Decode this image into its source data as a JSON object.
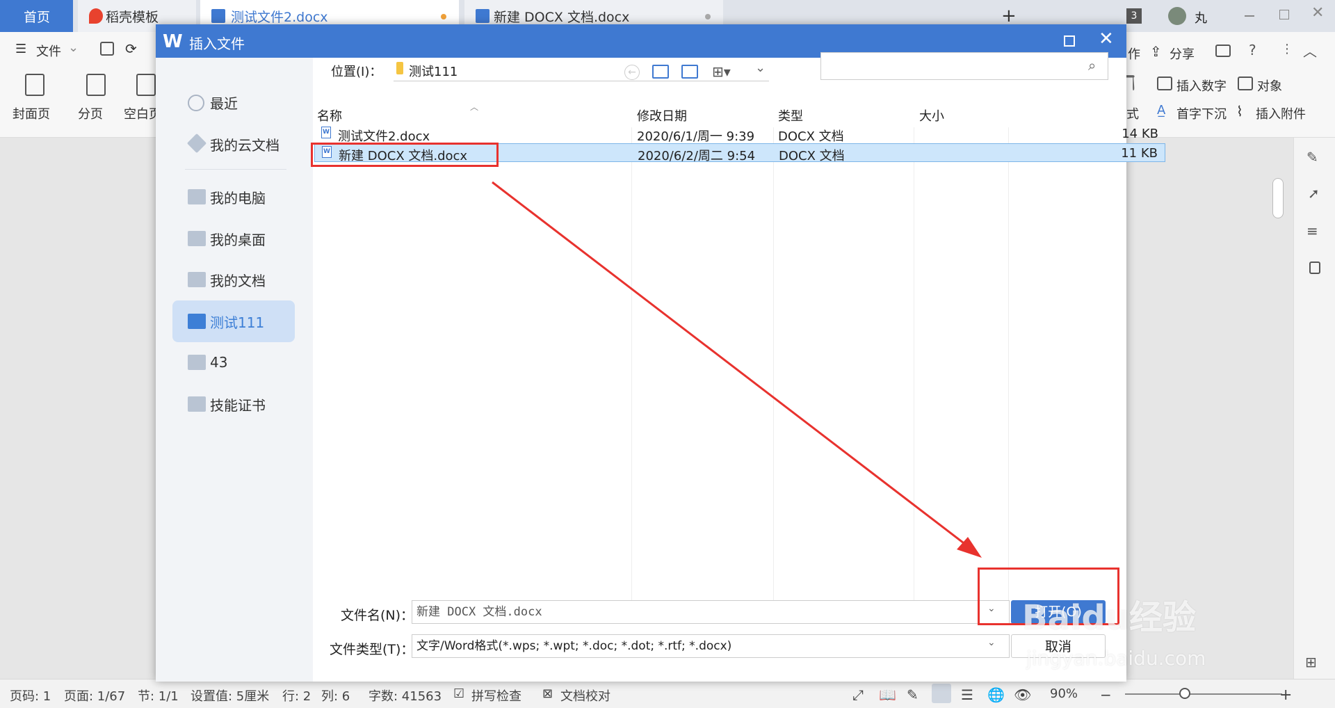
{
  "tabs": {
    "home": "首页",
    "template": "稻壳模板",
    "doc1": "测试文件2.docx",
    "doc2": "新建 DOCX 文档.docx",
    "window_count": "3",
    "user": "丸"
  },
  "ribbon": {
    "file": "文件",
    "cover": "封面页",
    "page_break": "分页",
    "blank_page": "空白页",
    "work": "作",
    "share": "分享",
    "insert_number": "插入数字",
    "object": "对象",
    "style": "式",
    "drop_cap": "首字下沉",
    "insert_attachment": "插入附件"
  },
  "dialog": {
    "title": "插入文件",
    "location_label": "位置(I)：",
    "location_value": "测试111",
    "search_placeholder": "",
    "sidebar": [
      {
        "label": "最近",
        "icon": "clock-icon"
      },
      {
        "label": "我的云文档",
        "icon": "cube-icon"
      },
      {
        "label": "我的电脑",
        "icon": "monitor-icon"
      },
      {
        "label": "我的桌面",
        "icon": "desktop-icon"
      },
      {
        "label": "我的文档",
        "icon": "folder-icon"
      },
      {
        "label": "测试111",
        "icon": "folder-icon",
        "active": true
      },
      {
        "label": "43",
        "icon": "folder-icon"
      },
      {
        "label": "技能证书",
        "icon": "folder-icon"
      }
    ],
    "columns": {
      "name": "名称",
      "date": "修改日期",
      "type": "类型",
      "size": "大小"
    },
    "files": [
      {
        "name": "测试文件2.docx",
        "date": "2020/6/1/周一 9:39",
        "type": "DOCX 文档",
        "size": "14 KB"
      },
      {
        "name": "新建 DOCX 文档.docx",
        "date": "2020/6/2/周二 9:54",
        "type": "DOCX 文档",
        "size": "11 KB"
      }
    ],
    "filename_label": "文件名(N)：",
    "filename_value": "新建 DOCX 文档.docx",
    "filetype_label": "文件类型(T)：",
    "filetype_value": "文字/Word格式(*.wps; *.wpt; *.doc; *.dot; *.rtf; *.docx)",
    "open_button": "打开(O)",
    "cancel_button": "取消"
  },
  "status": {
    "page_code": "页码: 1",
    "page": "页面: 1/67",
    "section": "节: 1/1",
    "setting": "设置值: 5厘米",
    "line": "行: 2",
    "col": "列: 6",
    "words": "字数: 41563",
    "spell": "拼写检查",
    "proof": "文档校对",
    "zoom": "90%"
  },
  "watermark": {
    "brand": "Baidu经验",
    "url": "jingyan.baidu.com"
  },
  "colors": {
    "accent": "#3f79d1",
    "annotation": "#e8322e"
  }
}
